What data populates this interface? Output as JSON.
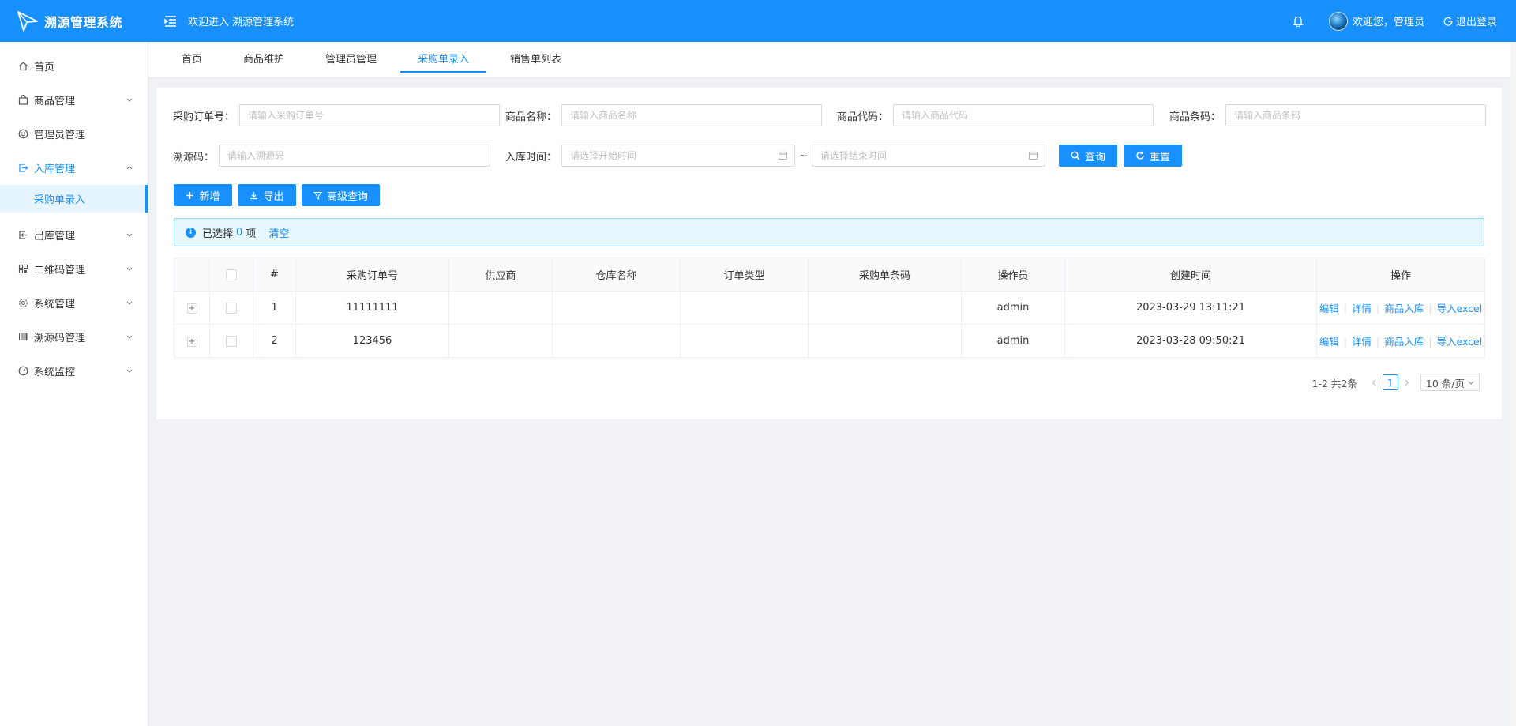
{
  "app": {
    "title": "溯源管理系统",
    "welcome": "欢迎进入 溯源管理系统",
    "user_greeting": "欢迎您，管理员",
    "logout": "退出登录",
    "accent_color": "#1890ff"
  },
  "sidebar": {
    "items": [
      {
        "label": "首页",
        "icon": "home-icon"
      },
      {
        "label": "商品管理",
        "icon": "bag-icon"
      },
      {
        "label": "管理员管理",
        "icon": "smile-icon"
      },
      {
        "label": "入库管理",
        "icon": "import-icon"
      },
      {
        "label": "采购单录入"
      },
      {
        "label": "出库管理",
        "icon": "export-icon"
      },
      {
        "label": "二维码管理",
        "icon": "qrcode-icon"
      },
      {
        "label": "系统管理",
        "icon": "gear-icon"
      },
      {
        "label": "溯源码管理",
        "icon": "barcode-icon"
      },
      {
        "label": "系统监控",
        "icon": "dashboard-icon"
      }
    ]
  },
  "tabs": [
    "首页",
    "商品维护",
    "管理员管理",
    "采购单录入",
    "销售单列表"
  ],
  "filters": {
    "order_no": {
      "label": "采购订单号：",
      "placeholder": "请输入采购订单号"
    },
    "product_name": {
      "label": "商品名称：",
      "placeholder": "请输入商品名称"
    },
    "product_code": {
      "label": "商品代码：",
      "placeholder": "请输入商品代码"
    },
    "product_barcode": {
      "label": "商品条码：",
      "placeholder": "请输入商品条码"
    },
    "trace_code": {
      "label": "溯源码：",
      "placeholder": "请输入溯源码"
    },
    "in_time": {
      "label": "入库时间：",
      "start_placeholder": "请选择开始时间",
      "end_placeholder": "请选择结束时间",
      "sep": "~"
    },
    "query_btn": "查询",
    "reset_btn": "重置"
  },
  "toolbar": {
    "add": "新增",
    "export": "导出",
    "advanced": "高级查询"
  },
  "selection": {
    "prefix": "已选择",
    "count": "0",
    "suffix": "项",
    "clear": "清空"
  },
  "table": {
    "headers": [
      "#",
      "采购订单号",
      "供应商",
      "仓库名称",
      "订单类型",
      "采购单条码",
      "操作员",
      "创建时间",
      "操作"
    ],
    "rows": [
      {
        "idx": "1",
        "order_no": "11111111",
        "supplier": "",
        "warehouse": "",
        "type": "",
        "barcode": "",
        "operator": "admin",
        "created": "2023-03-29 13:11:21"
      },
      {
        "idx": "2",
        "order_no": "123456",
        "supplier": "",
        "warehouse": "",
        "type": "",
        "barcode": "",
        "operator": "admin",
        "created": "2023-03-28 09:50:21"
      }
    ],
    "actions": [
      "编辑",
      "详情",
      "商品入库",
      "导入excel"
    ],
    "expand_symbol": "+"
  },
  "pagination": {
    "summary": "1-2 共2条",
    "current": "1",
    "page_size": "10 条/页"
  }
}
